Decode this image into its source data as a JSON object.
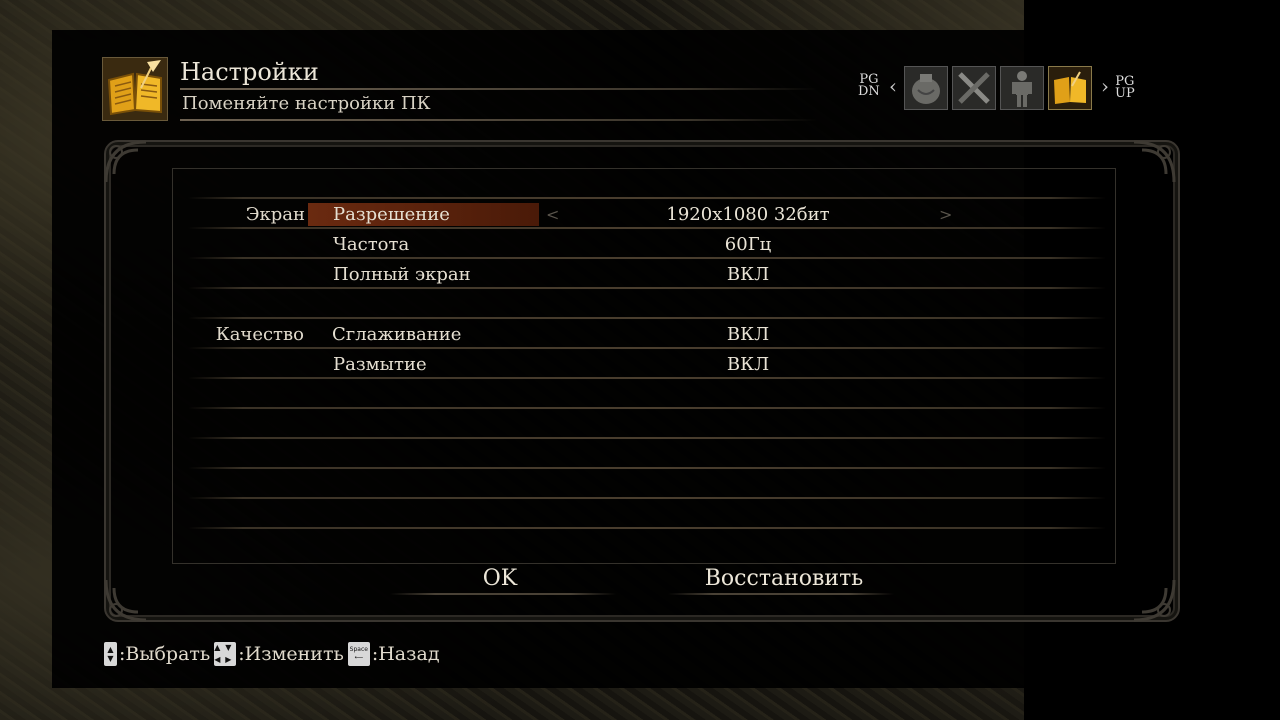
{
  "header": {
    "title": "Настройки",
    "subtitle": "Поменяйте настройки ПК",
    "pg_dn": [
      "PG",
      "DN"
    ],
    "pg_up": [
      "PG",
      "UP"
    ],
    "tabs": [
      {
        "icon": "pouch-icon",
        "active": false
      },
      {
        "icon": "crossed-swords-icon",
        "active": false
      },
      {
        "icon": "body-figure-icon",
        "active": false
      },
      {
        "icon": "book-icon",
        "active": true
      }
    ]
  },
  "settings": {
    "screen": {
      "category": "Экран",
      "rows": [
        {
          "label": "Разрешение",
          "value": "1920x1080 32бит",
          "selected": true
        },
        {
          "label": "Частота",
          "value": "60Гц"
        },
        {
          "label": "Полный экран",
          "value": "ВКЛ"
        }
      ]
    },
    "quality": {
      "category": "Качество",
      "rows": [
        {
          "label": "Сглаживание",
          "value": "ВКЛ"
        },
        {
          "label": "Размытие",
          "value": "ВКЛ"
        }
      ]
    }
  },
  "buttons": {
    "ok": "OK",
    "restore": "Восстановить"
  },
  "footer": {
    "select": ":Выбрать",
    "change": ":Изменить",
    "back": ":Назад",
    "space_key": "Space"
  },
  "colors": {
    "selection": "#6a2a10",
    "accent_gold": "#e8b020"
  }
}
